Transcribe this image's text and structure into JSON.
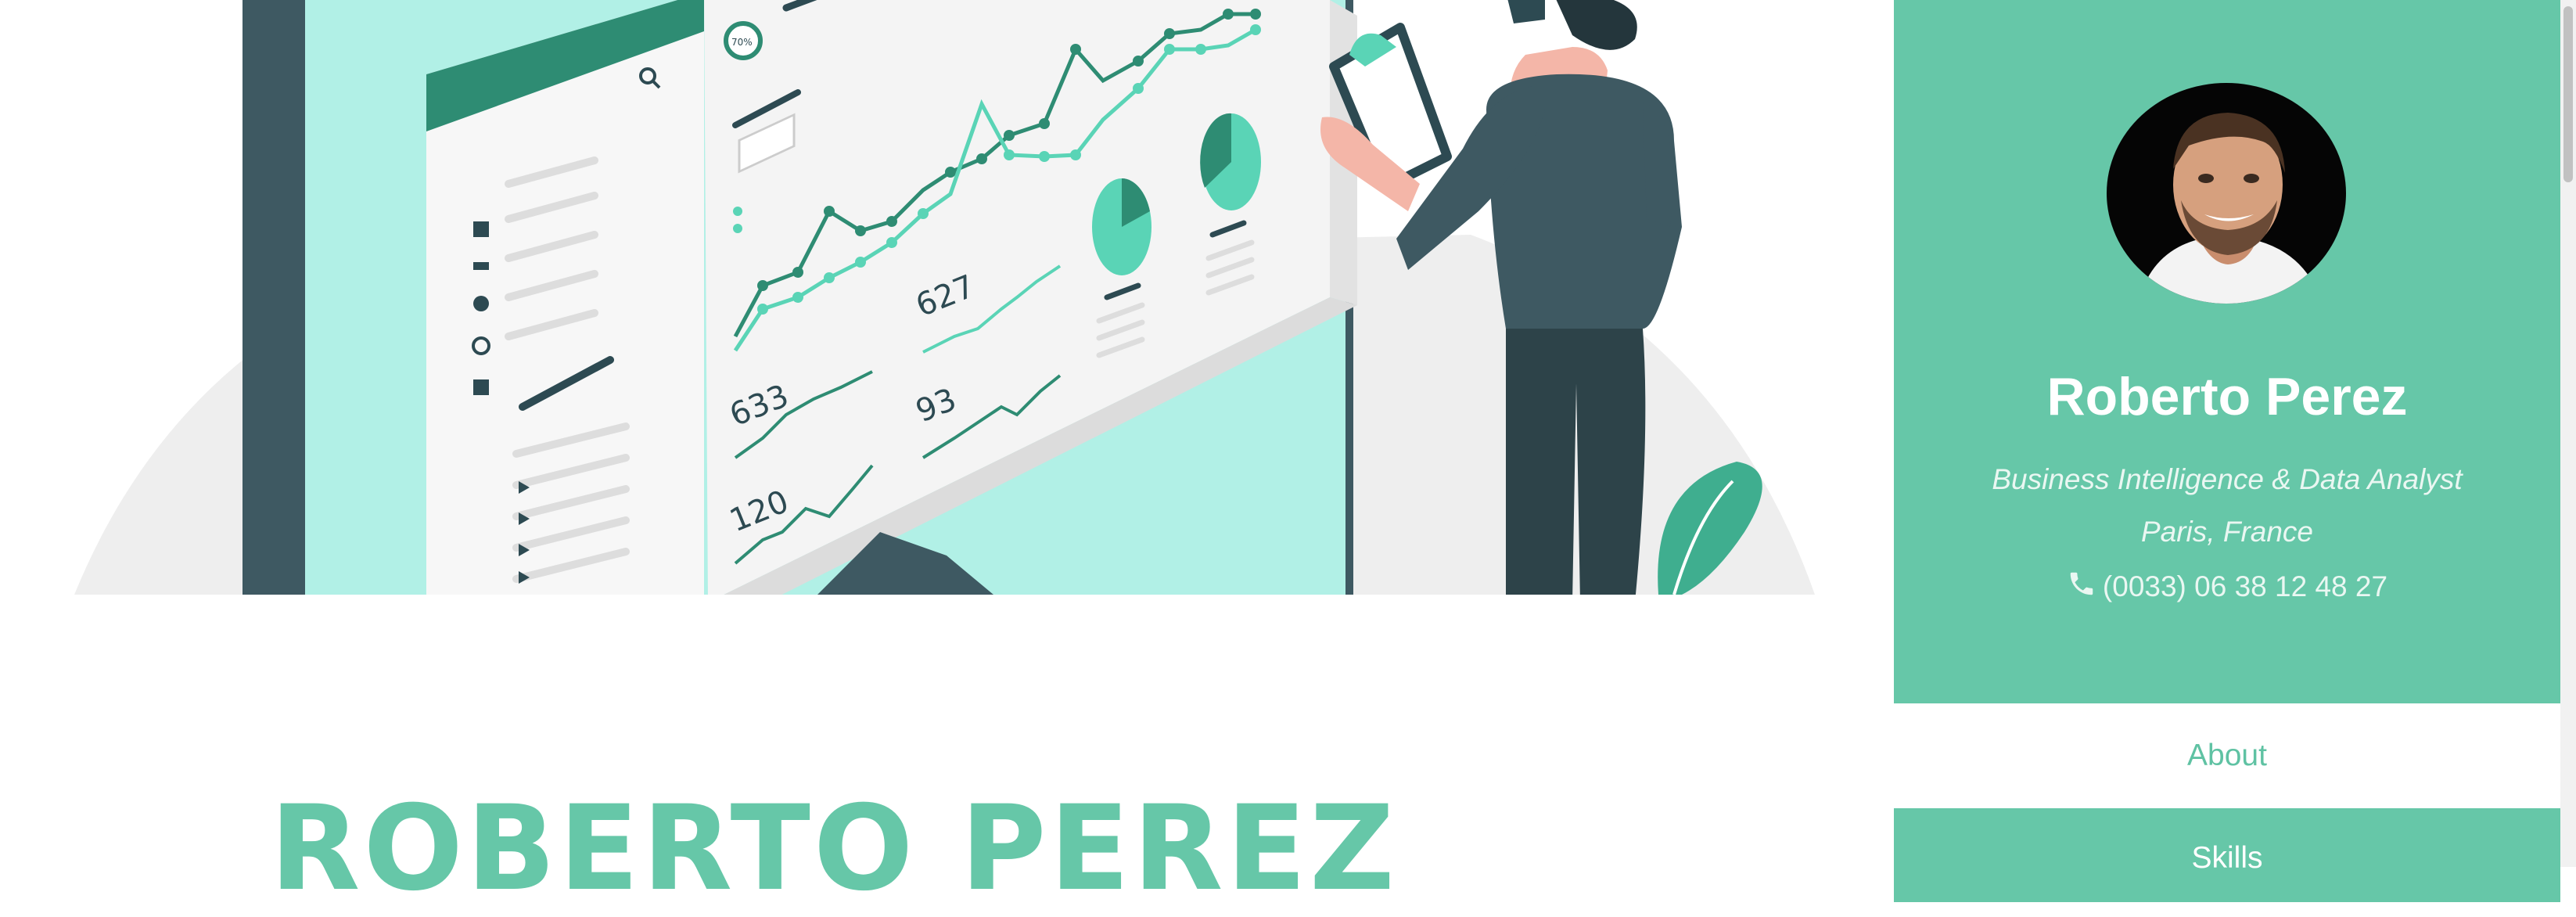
{
  "hero": {
    "illustration_icon": "analytics-dashboard-illustration",
    "dashboard_numbers": [
      "627",
      "633",
      "93",
      "120"
    ],
    "gauge_label": "70%",
    "title": "ROBERTO PEREZ"
  },
  "profile": {
    "avatar_icon": "profile-photo",
    "name": "Roberto Perez",
    "role": "Business Intelligence & Data Analyst",
    "location": "Paris, France",
    "phone_icon": "phone-icon",
    "phone": "(0033) 06 38 12 48 27"
  },
  "nav": {
    "about": "About",
    "skills": "Skills"
  },
  "colors": {
    "accent": "#66c7a8",
    "dark": "#2d4a52",
    "light_teal": "#b1f0e6"
  }
}
